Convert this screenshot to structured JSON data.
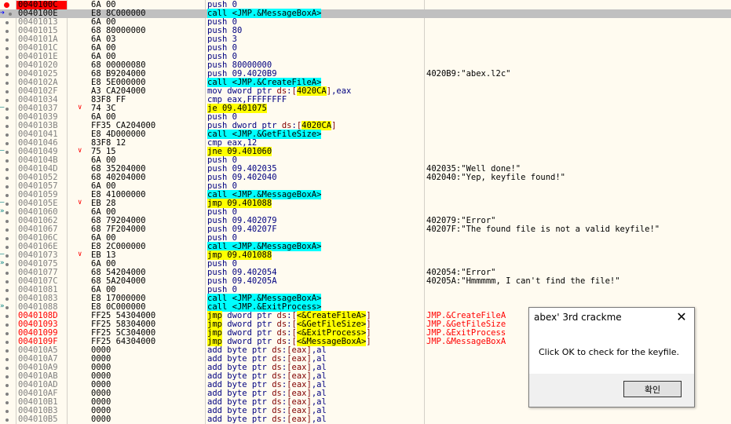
{
  "dialog": {
    "title": "abex' 3rd crackme",
    "close_glyph": "✕",
    "message": "Click OK to check for the keyfile.",
    "ok_label": "확인"
  },
  "rows": [
    {
      "a": "0040100C",
      "b": "6A 00",
      "m": "push",
      "o": "0",
      "bp": true
    },
    {
      "a": "0040100E",
      "b": "E8 8C000000",
      "m": "call",
      "hl": "call",
      "o": "<JMP.&MessageBoxA>",
      "sel": true,
      "eip": true
    },
    {
      "a": "00401013",
      "b": "6A 00",
      "m": "push",
      "o": "0"
    },
    {
      "a": "00401015",
      "b": "68 80000000",
      "m": "push",
      "o": "80"
    },
    {
      "a": "0040101A",
      "b": "6A 03",
      "m": "push",
      "o": "3"
    },
    {
      "a": "0040101C",
      "b": "6A 00",
      "m": "push",
      "o": "0"
    },
    {
      "a": "0040101E",
      "b": "6A 00",
      "m": "push",
      "o": "0"
    },
    {
      "a": "00401020",
      "b": "68 00000080",
      "m": "push",
      "o": "80000000"
    },
    {
      "a": "00401025",
      "b": "68 B9204000",
      "m": "push",
      "o": "09.4020B9",
      "c": "4020B9:\"abex.l2c\""
    },
    {
      "a": "0040102A",
      "b": "E8 5E000000",
      "m": "call",
      "hl": "call",
      "o": "<JMP.&CreateFileA>"
    },
    {
      "a": "0040102F",
      "b": "A3 CA204000",
      "m": "mov",
      "o": "dword ptr ds:[4020CA],eax",
      "kind": "mov"
    },
    {
      "a": "00401034",
      "b": "83F8 FF",
      "m": "cmp",
      "o": "eax,FFFFFFFF"
    },
    {
      "a": "00401037",
      "b": "74 3C",
      "m": "je",
      "hl": "jump",
      "o": "09.401075",
      "jv": true,
      "jm": "–"
    },
    {
      "a": "00401039",
      "b": "6A 00",
      "m": "push",
      "o": "0"
    },
    {
      "a": "0040103B",
      "b": "FF35 CA204000",
      "m": "push",
      "o": "dword ptr ds:[4020CA]",
      "kind": "mem"
    },
    {
      "a": "00401041",
      "b": "E8 4D000000",
      "m": "call",
      "hl": "call",
      "o": "<JMP.&GetFileSize>"
    },
    {
      "a": "00401046",
      "b": "83F8 12",
      "m": "cmp",
      "o": "eax,12"
    },
    {
      "a": "00401049",
      "b": "75 15",
      "m": "jne",
      "hl": "jump",
      "o": "09.401060",
      "jv": true,
      "jm": "–"
    },
    {
      "a": "0040104B",
      "b": "6A 00",
      "m": "push",
      "o": "0"
    },
    {
      "a": "0040104D",
      "b": "68 35204000",
      "m": "push",
      "o": "09.402035",
      "c": "402035:\"Well done!\""
    },
    {
      "a": "00401052",
      "b": "68 40204000",
      "m": "push",
      "o": "09.402040",
      "c": "402040:\"Yep, keyfile found!\""
    },
    {
      "a": "00401057",
      "b": "6A 00",
      "m": "push",
      "o": "0"
    },
    {
      "a": "00401059",
      "b": "E8 41000000",
      "m": "call",
      "hl": "call",
      "o": "<JMP.&MessageBoxA>"
    },
    {
      "a": "0040105E",
      "b": "EB 28",
      "m": "jmp",
      "hl": "jump",
      "o": "09.401088",
      "jv": true,
      "jm": "–"
    },
    {
      "a": "00401060",
      "b": "6A 00",
      "m": "push",
      "o": "0",
      "jm": "»"
    },
    {
      "a": "00401062",
      "b": "68 79204000",
      "m": "push",
      "o": "09.402079",
      "c": "402079:\"Error\""
    },
    {
      "a": "00401067",
      "b": "68 7F204000",
      "m": "push",
      "o": "09.40207F",
      "c": "40207F:\"The found file is not a valid keyfile!\""
    },
    {
      "a": "0040106C",
      "b": "6A 00",
      "m": "push",
      "o": "0"
    },
    {
      "a": "0040106E",
      "b": "E8 2C000000",
      "m": "call",
      "hl": "call",
      "o": "<JMP.&MessageBoxA>"
    },
    {
      "a": "00401073",
      "b": "EB 13",
      "m": "jmp",
      "hl": "jump",
      "o": "09.401088",
      "jv": true,
      "jm": "–"
    },
    {
      "a": "00401075",
      "b": "6A 00",
      "m": "push",
      "o": "0",
      "jm": "»"
    },
    {
      "a": "00401077",
      "b": "68 54204000",
      "m": "push",
      "o": "09.402054",
      "c": "402054:\"Error\""
    },
    {
      "a": "0040107C",
      "b": "68 5A204000",
      "m": "push",
      "o": "09.40205A",
      "c": "40205A:\"Hmmmmm, I can't find the file!\""
    },
    {
      "a": "00401081",
      "b": "6A 00",
      "m": "push",
      "o": "0"
    },
    {
      "a": "00401083",
      "b": "E8 17000000",
      "m": "call",
      "hl": "call",
      "o": "<JMP.&MessageBoxA>"
    },
    {
      "a": "00401088",
      "b": "E8 0C000000",
      "m": "call",
      "hl": "call",
      "o": "<JMP.&ExitProcess>",
      "jm": "»"
    },
    {
      "a": "0040108D",
      "b": "FF25 54304000",
      "m": "jmp",
      "hl": "jump",
      "o": "dword ptr ds:[<&CreateFileA>]",
      "kind": "iat",
      "c": "JMP.&CreateFileA",
      "ciat": true,
      "iat": true
    },
    {
      "a": "00401093",
      "b": "FF25 58304000",
      "m": "jmp",
      "hl": "jump",
      "o": "dword ptr ds:[<&GetFileSize>]",
      "kind": "iat",
      "c": "JMP.&GetFileSize",
      "ciat": true,
      "iat": true
    },
    {
      "a": "00401099",
      "b": "FF25 5C304000",
      "m": "jmp",
      "hl": "jump",
      "o": "dword ptr ds:[<&ExitProcess>]",
      "kind": "iat",
      "c": "JMP.&ExitProcess",
      "ciat": true,
      "iat": true
    },
    {
      "a": "0040109F",
      "b": "FF25 64304000",
      "m": "jmp",
      "hl": "jump",
      "o": "dword ptr ds:[<&MessageBoxA>]",
      "kind": "iat",
      "c": "JMP.&MessageBoxA",
      "ciat": true,
      "iat": true
    },
    {
      "a": "004010A5",
      "b": "0000",
      "m": "add",
      "o": "byte ptr ds:[eax],al",
      "kind": "mem"
    },
    {
      "a": "004010A7",
      "b": "0000",
      "m": "add",
      "o": "byte ptr ds:[eax],al",
      "kind": "mem"
    },
    {
      "a": "004010A9",
      "b": "0000",
      "m": "add",
      "o": "byte ptr ds:[eax],al",
      "kind": "mem"
    },
    {
      "a": "004010AB",
      "b": "0000",
      "m": "add",
      "o": "byte ptr ds:[eax],al",
      "kind": "mem"
    },
    {
      "a": "004010AD",
      "b": "0000",
      "m": "add",
      "o": "byte ptr ds:[eax],al",
      "kind": "mem"
    },
    {
      "a": "004010AF",
      "b": "0000",
      "m": "add",
      "o": "byte ptr ds:[eax],al",
      "kind": "mem"
    },
    {
      "a": "004010B1",
      "b": "0000",
      "m": "add",
      "o": "byte ptr ds:[eax],al",
      "kind": "mem"
    },
    {
      "a": "004010B3",
      "b": "0000",
      "m": "add",
      "o": "byte ptr ds:[eax],al",
      "kind": "mem"
    },
    {
      "a": "004010B5",
      "b": "0000",
      "m": "add",
      "o": "byte ptr ds:[eax],al",
      "kind": "mem"
    }
  ]
}
